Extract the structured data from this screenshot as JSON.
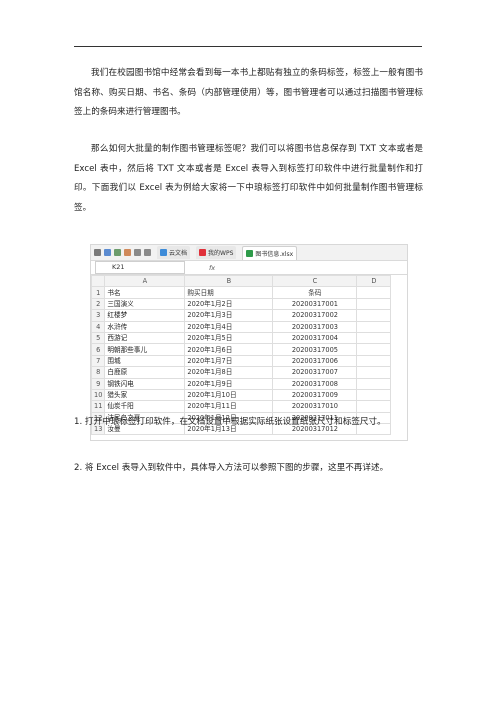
{
  "paragraphs": {
    "intro": "我们在校园图书馆中经常会看到每一本书上都贴有独立的条码标签，标签上一般有图书馆名称、购买日期、书名、条码（内部管理使用）等，图书管理者可以通过扫描图书管理标签上的条码来进行管理图书。",
    "question": "那么如何大批量的制作图书管理标签呢？我们可以将图书信息保存到 TXT 文本或者是 Excel 表中，然后将 TXT 文本或者是 Excel 表导入到标签打印软件中进行批量制作和打印。下面我们以 Excel 表为例给大家将一下中琅标签打印软件中如何批量制作图书管理标签。",
    "step1": "1.   打开中琅标签打印软件，在文档设置中根据实际纸张设置纸张尺寸和标签尺寸。",
    "step2": "2.   将 Excel 表导入到软件中，具体导入方法可以参照下图的步骤，这里不再详述。"
  },
  "spreadsheet": {
    "tabs": [
      "云文档",
      "我的WPS",
      "图书信息.xlsx"
    ],
    "cell_ref": "K21",
    "fx_label": "fx",
    "column_headers": [
      "A",
      "B",
      "C",
      "D"
    ],
    "rows": [
      [
        "1",
        "书名",
        "购买日期",
        "条码",
        ""
      ],
      [
        "2",
        "三国演义",
        "2020年1月2日",
        "20200317001",
        ""
      ],
      [
        "3",
        "红楼梦",
        "2020年1月3日",
        "20200317002",
        ""
      ],
      [
        "4",
        "水浒传",
        "2020年1月4日",
        "20200317003",
        ""
      ],
      [
        "5",
        "西游记",
        "2020年1月5日",
        "20200317004",
        ""
      ],
      [
        "6",
        "明朝那些事儿",
        "2020年1月6日",
        "20200317005",
        ""
      ],
      [
        "7",
        "围城",
        "2020年1月7日",
        "20200317006",
        ""
      ],
      [
        "8",
        "白鹿原",
        "2020年1月8日",
        "20200317007",
        ""
      ],
      [
        "9",
        "钢铁闪电",
        "2020年1月9日",
        "20200317008",
        ""
      ],
      [
        "10",
        "猎头家",
        "2020年1月10日",
        "20200317009",
        ""
      ],
      [
        "11",
        "仙炭千阳",
        "2020年1月11日",
        "20200317010",
        ""
      ],
      [
        "12",
        "洁民鸟之夏",
        "2020年1月12日",
        "20200317011",
        ""
      ],
      [
        "13",
        "汝曼",
        "2020年1月13日",
        "20200317012",
        ""
      ]
    ]
  }
}
